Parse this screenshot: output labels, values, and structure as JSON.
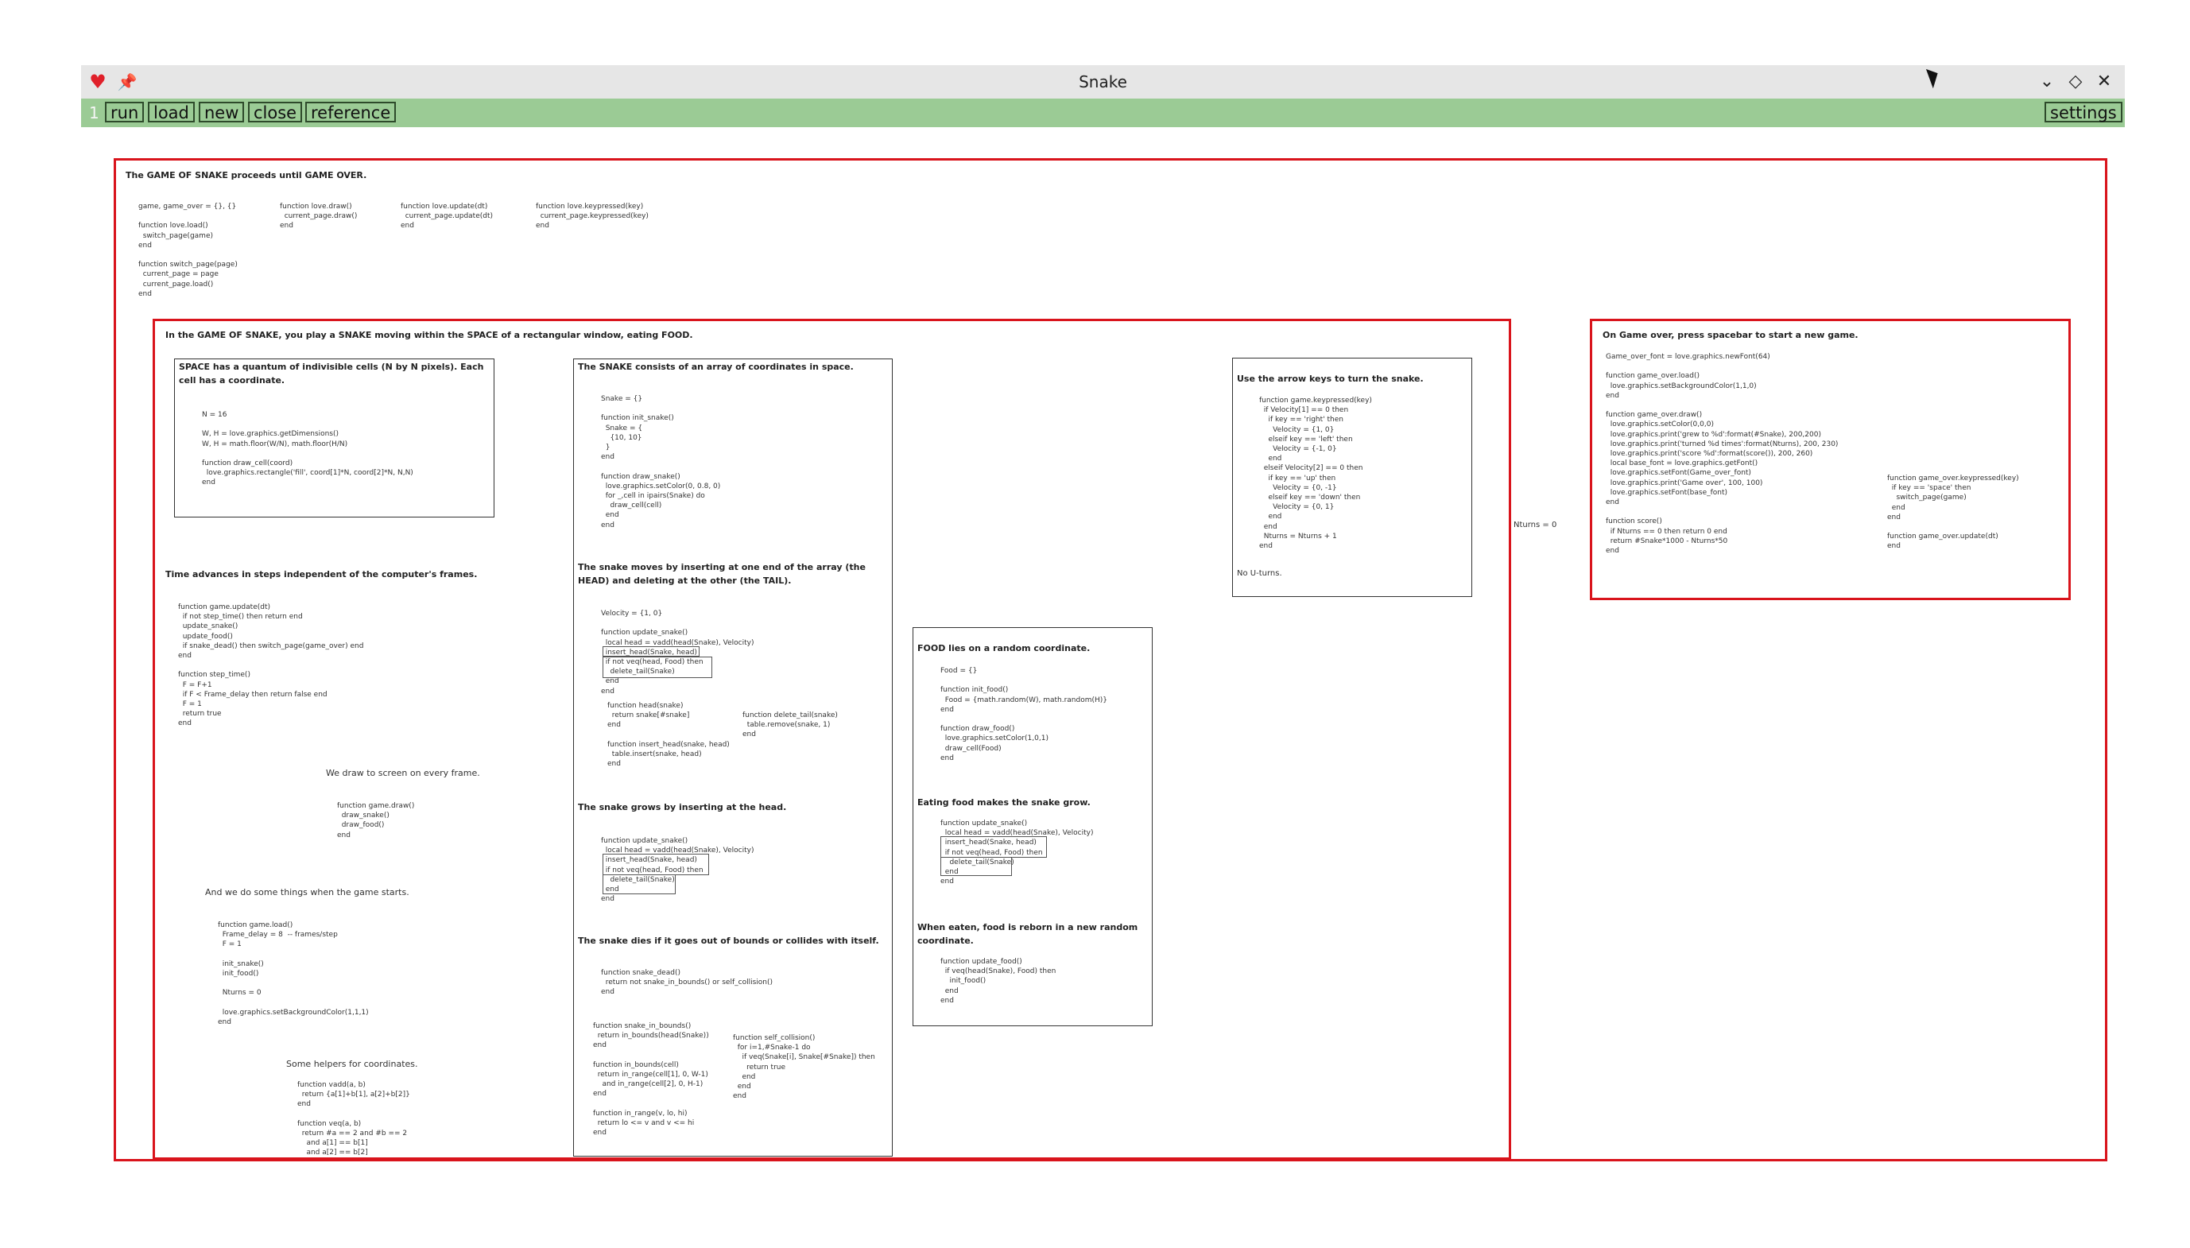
{
  "window": {
    "title": "Snake",
    "titlebar_icons": [
      "heart-icon",
      "pin-icon"
    ],
    "controls": [
      "chevron-down-icon",
      "diamond-icon",
      "close-icon"
    ]
  },
  "toolbar": {
    "line_number": "1",
    "buttons": [
      "run",
      "load",
      "new",
      "close",
      "reference"
    ],
    "settings": "settings"
  },
  "colors": {
    "toolbar": "#9bcb95",
    "frame": "#d9141c",
    "titlebar": "#e6e6e6"
  },
  "doc": {
    "main_heading": "The GAME OF SNAKE proceeds until GAME OVER.",
    "main_code": [
      "game, game_over = {}, {}\n\nfunction love.load()\n  switch_page(game)\nend\n\nfunction switch_page(page)\n  current_page = page\n  current_page.load()\nend",
      "function love.draw()\n  current_page.draw()\nend",
      "function love.update(dt)\n  current_page.update(dt)\nend",
      "function love.keypressed(key)\n  current_page.keypressed(key)\nend"
    ],
    "game": {
      "heading": "In the GAME OF SNAKE, you play a SNAKE moving within the SPACE of a rectangular window, eating FOOD.",
      "space_heading": "SPACE has a quantum of indivisible cells (N by N pixels). Each\ncell has a coordinate.",
      "space_code": "N = 16\n\nW, H = love.graphics.getDimensions()\nW, H = math.floor(W/N), math.floor(H/N)\n\nfunction draw_cell(coord)\n  love.graphics.rectangle('fill', coord[1]*N, coord[2]*N, N,N)\nend",
      "time_heading": "Time advances in steps independent of the computer's frames.",
      "time_code": "function game.update(dt)\n  if not step_time() then return end\n  update_snake()\n  update_food()\n  if snake_dead() then switch_page(game_over) end\nend\n\nfunction step_time()\n  F = F+1\n  if F < Frame_delay then return false end\n  F = 1\n  return true\nend",
      "draw_note": "We draw to screen on every frame.",
      "draw_code": "function game.draw()\n  draw_snake()\n  draw_food()\nend",
      "start_note": "And we do some things when the game starts.",
      "start_code": "function game.load()\n  Frame_delay = 8  -- frames/step\n  F = 1\n\n  init_snake()\n  init_food()\n\n  Nturns = 0\n\n  love.graphics.setBackgroundColor(1,1,1)\nend",
      "helpers_note": "Some helpers for coordinates.",
      "helpers_code": "function vadd(a, b)\n  return {a[1]+b[1], a[2]+b[2]}\nend\n\nfunction veq(a, b)\n  return #a == 2 and #b == 2\n    and a[1] == b[1]\n    and a[2] == b[2]",
      "snake_heading": "The SNAKE consists of an array of coordinates in space.",
      "snake_code": "Snake = {}\n\nfunction init_snake()\n  Snake = {\n    {10, 10}\n  }\nend\n\nfunction draw_snake()\n  love.graphics.setColor(0, 0.8, 0)\n  for _,cell in ipairs(Snake) do\n    draw_cell(cell)\n  end\nend",
      "moves_heading": "The snake moves by inserting at one end of the array (the\nHEAD) and deleting at the other (the TAIL).",
      "moves_code": "Velocity = {1, 0}\n\nfunction update_snake()\n  local head = vadd(head(Snake), Velocity)\n  insert_head(Snake, head)\n  if not veq(head, Food) then\n    delete_tail(Snake)\n  end\nend",
      "head_code": "function head(snake)\n  return snake[#snake]\nend\n\nfunction insert_head(snake, head)\n  table.insert(snake, head)\nend",
      "tail_code": "function delete_tail(snake)\n  table.remove(snake, 1)\nend",
      "grows_heading": "The snake grows by inserting at the head.",
      "grows_code": "function update_snake()\n  local head = vadd(head(Snake), Velocity)\n  insert_head(Snake, head)\n  if not veq(head, Food) then\n    delete_tail(Snake)\n  end\nend",
      "dies_heading": "The snake dies if it goes out of bounds or collides with itself.",
      "dies_code": "function snake_dead()\n  return not snake_in_bounds() or self_collision()\nend",
      "bounds_code": "function snake_in_bounds()\n  return in_bounds(head(Snake))\nend\n\nfunction in_bounds(cell)\n  return in_range(cell[1], 0, W-1)\n    and in_range(cell[2], 0, H-1)\nend\n\nfunction in_range(v, lo, hi)\n  return lo <= v and v <= hi\nend",
      "collision_code": "function self_collision()\n  for i=1,#Snake-1 do\n    if veq(Snake[i], Snake[#Snake]) then\n      return true\n    end\n  end\nend",
      "food_heading": "FOOD lies on a random coordinate.",
      "food_code": "Food = {}\n\nfunction init_food()\n  Food = {math.random(W), math.random(H)}\nend\n\nfunction draw_food()\n  love.graphics.setColor(1,0,1)\n  draw_cell(Food)\nend",
      "eating_heading": "Eating food makes the snake grow.",
      "eating_code": "function update_snake()\n  local head = vadd(head(Snake), Velocity)\n  insert_head(Snake, head)\n  if not veq(head, Food) then\n    delete_tail(Snake)\n  end\nend",
      "reborn_heading": "When eaten, food is reborn in a new random\ncoordinate.",
      "reborn_code": "function update_food()\n  if veq(head(Snake), Food) then\n    init_food()\n  end\nend",
      "arrows_heading": "Use the arrow keys to turn the snake.",
      "arrows_code": "function game.keypressed(key)\n  if Velocity[1] == 0 then\n    if key == 'right' then\n      Velocity = {1, 0}\n    elseif key == 'left' then\n      Velocity = {-1, 0}\n    end\n  elseif Velocity[2] == 0 then\n    if key == 'up' then\n      Velocity = {0, -1}\n    elseif key == 'down' then\n      Velocity = {0, 1}\n    end\n  end\n  Nturns = Nturns + 1\nend",
      "no_uturns": "No U-turns.",
      "nturns_label": "Nturns = 0"
    },
    "game_over": {
      "heading": "On Game over, press spacebar to start a new game.",
      "code": "Game_over_font = love.graphics.newFont(64)\n\nfunction game_over.load()\n  love.graphics.setBackgroundColor(1,1,0)\nend\n\nfunction game_over.draw()\n  love.graphics.setColor(0,0,0)\n  love.graphics.print('grew to %d':format(#Snake), 200,200)\n  love.graphics.print('turned %d times':format(Nturns), 200, 230)\n  love.graphics.print('score %d':format(score()), 200, 260)\n  local base_font = love.graphics.getFont()\n  love.graphics.setFont(Game_over_font)\n  love.graphics.print('Game over', 100, 100)\n  love.graphics.setFont(base_font)\nend\n\nfunction score()\n  if Nturns == 0 then return 0 end\n  return #Snake*1000 - Nturns*50\nend",
      "keypressed_code": "function game_over.keypressed(key)\n  if key == 'space' then\n    switch_page(game)\n  end\nend\n\nfunction game_over.update(dt)\nend"
    }
  }
}
